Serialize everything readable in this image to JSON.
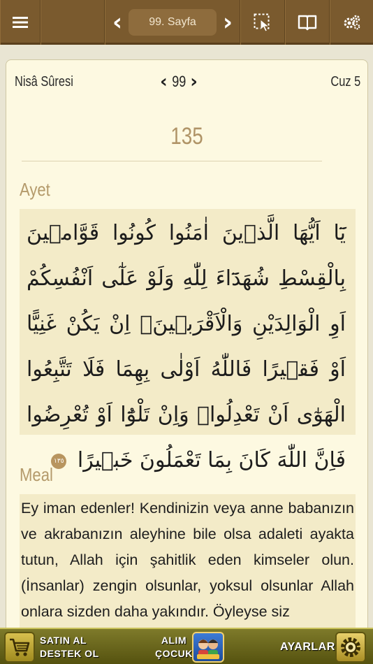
{
  "toolbar": {
    "page_label": "99. Sayfa",
    "prev_symbol": "‹",
    "next_symbol": "›"
  },
  "header": {
    "sure_name": "Nisâ Sûresi",
    "page_number": "99",
    "cuz": "Cuz 5"
  },
  "ayah": {
    "number": "135",
    "section_title": "Ayet",
    "arabic": "يَٓا اَيُّهَا الَّذٖينَ اٰمَنُوا كُونُوا قَوَّامٖينَ بِالْقِسْطِ شُهَدَٓاءَ لِلّٰهِ وَلَوْ عَلٰٓى اَنْفُسِكُمْ اَوِ الْوَالِدَيْنِ وَالْاَقْرَبٖينَۚ اِنْ يَكُنْ غَنِيًّا اَوْ فَقٖيرًا فَاللّٰهُ اَوْلٰى بِهِمَا فَلَا تَتَّبِعُوا الْهَوٰٓى اَنْ تَعْدِلُواۚ وَاِنْ تَلْوُٓا اَوْ تُعْرِضُوا فَاِنَّ اللّٰهَ كَانَ بِمَا تَعْمَلُونَ خَبٖيرًا",
    "ayah_marker": "١٣٥"
  },
  "meal": {
    "section_title": "Meal",
    "text": "Ey iman edenler! Kendinizin veya anne babanızın ve akrabanızın aleyhine bile olsa adaleti ayakta tutun, Allah için şahitlik eden kimseler olun. (İnsanlar) zengin olsunlar, yoksul olsunlar Allah onlara sizden daha yakındır. Öyleyse siz"
  },
  "banner": {
    "buy_line1": "SATIN AL",
    "buy_line2": "DESTEK OL",
    "alim_line1": "ALIM",
    "alim_line2": "ÇOCUK",
    "settings_label": "AYARLAR"
  },
  "colors": {
    "toolbar_bg": "#7a5a2e",
    "card_bg": "#fdf9e1",
    "text_box_bg": "#f3ebc8",
    "section_title": "#b49a6b",
    "banner_bg": "#6b6720"
  }
}
